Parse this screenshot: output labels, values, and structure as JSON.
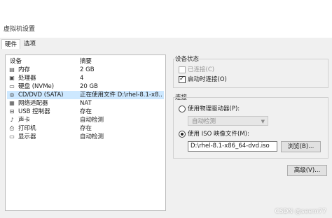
{
  "window": {
    "title": "虚拟机设置"
  },
  "tabs": [
    {
      "label": "硬件",
      "active": true
    },
    {
      "label": "选项",
      "active": false
    }
  ],
  "device_table": {
    "headers": {
      "device": "设备",
      "summary": "摘要"
    },
    "rows": [
      {
        "icon": "memory-icon",
        "name": "内存",
        "summary": "2 GB"
      },
      {
        "icon": "processor-icon",
        "name": "处理器",
        "summary": "4"
      },
      {
        "icon": "hard-disk-icon",
        "name": "硬盘 (NVMe)",
        "summary": "20 GB"
      },
      {
        "icon": "cd-dvd-icon",
        "name": "CD/DVD (SATA)",
        "summary": "正在使用文件 D:\\rhel-8.1-x8...",
        "selected": true
      },
      {
        "icon": "network-adapter-icon",
        "name": "网络适配器",
        "summary": "NAT"
      },
      {
        "icon": "usb-controller-icon",
        "name": "USB 控制器",
        "summary": "存在"
      },
      {
        "icon": "sound-card-icon",
        "name": "声卡",
        "summary": "自动检测"
      },
      {
        "icon": "printer-icon",
        "name": "打印机",
        "summary": "存在"
      },
      {
        "icon": "display-icon",
        "name": "显示器",
        "summary": "自动检测"
      }
    ]
  },
  "device_status": {
    "title": "设备状态",
    "connected_label": "已连接(C)",
    "connected_checked": false,
    "connect_at_poweron_label": "启动时连接(O)",
    "connect_at_poweron_checked": true
  },
  "connection": {
    "title": "连接",
    "physical_drive_label": "使用物理驱动器(P):",
    "physical_drive_value": "自动检测",
    "iso_label": "使用 ISO 映像文件(M):",
    "iso_path": "D:\\rhel-8.1-x86_64-dvd.iso",
    "browse_label": "浏览(B)...",
    "selected": "iso"
  },
  "advanced_label": "高级(V)...",
  "watermark": "CSDN @seem77",
  "colors": {
    "selection": "#cde8ff",
    "background": "#f0f0f0"
  }
}
